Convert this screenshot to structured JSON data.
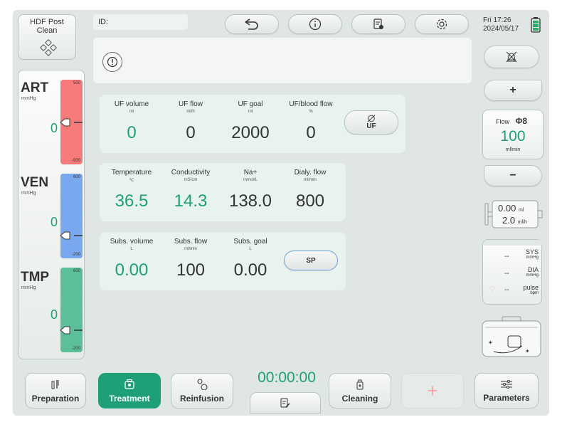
{
  "header": {
    "mode_line1": "HDF Post",
    "mode_line2": "Clean",
    "id_label": "ID:",
    "datetime_line1": "Fri  17:26",
    "datetime_line2": "2024/05/17"
  },
  "gauges": {
    "art": {
      "label": "ART",
      "unit": "mmHg",
      "max": "500",
      "min": "-500",
      "value": "0",
      "color": "#f77a7a"
    },
    "ven": {
      "label": "VEN",
      "unit": "mmHg",
      "max": "600",
      "min": "-200",
      "value": "0",
      "color": "#7aa8ee"
    },
    "tmp": {
      "label": "TMP",
      "unit": "mmHg",
      "max": "600",
      "min": "-200",
      "value": "0",
      "color": "#5dbf9a"
    }
  },
  "uf": {
    "volume": {
      "label": "UF volume",
      "unit": "ml",
      "value": "0"
    },
    "flow": {
      "label": "UF flow",
      "unit": "ml/h",
      "value": "0"
    },
    "goal": {
      "label": "UF goal",
      "unit": "ml",
      "value": "2000"
    },
    "ratio": {
      "label": "UF/blood flow",
      "unit": "%",
      "value": "0"
    },
    "button": "UF"
  },
  "dialysate": {
    "temperature": {
      "label": "Temperature",
      "unit": "℃",
      "value": "36.5"
    },
    "conductivity": {
      "label": "Conductivity",
      "unit": "mS/cm",
      "value": "14.3"
    },
    "na": {
      "label": "Na+",
      "unit": "mmol/L",
      "value": "138.0"
    },
    "dialy_flow": {
      "label": "Dialy. flow",
      "unit": "ml/min",
      "value": "800"
    }
  },
  "subs": {
    "volume": {
      "label": "Subs. volume",
      "unit": "L",
      "value": "0.00"
    },
    "flow": {
      "label": "Subs. flow",
      "unit": "ml/min",
      "value": "100"
    },
    "goal": {
      "label": "Subs. goal",
      "unit": "L",
      "value": "0.00"
    },
    "button": "SP"
  },
  "right": {
    "plus": "+",
    "minus": "−",
    "flow_label": "Flow",
    "flow_phi": "Φ8",
    "flow_value": "100",
    "flow_unit": "ml/min",
    "syringe_value1": "0.00",
    "syringe_unit1": "ml",
    "syringe_value2": "2.0",
    "syringe_unit2": "ml/h",
    "bp": {
      "sys_label": "SYS",
      "sys_unit": "mmHg",
      "sys_value": "--",
      "dia_label": "DIA",
      "dia_unit": "mmHg",
      "dia_value": "--",
      "pulse_label": "pulse",
      "pulse_unit": "bpm",
      "pulse_value": "--"
    }
  },
  "bottom": {
    "preparation": "Preparation",
    "treatment": "Treatment",
    "reinfusion": "Reinfusion",
    "timer": "00:00:00",
    "cleaning": "Cleaning",
    "add": "+",
    "parameters": "Parameters"
  },
  "colors": {
    "accent": "#1f9f77",
    "panel": "#e9f3ee",
    "background": "#dfe6e4"
  }
}
